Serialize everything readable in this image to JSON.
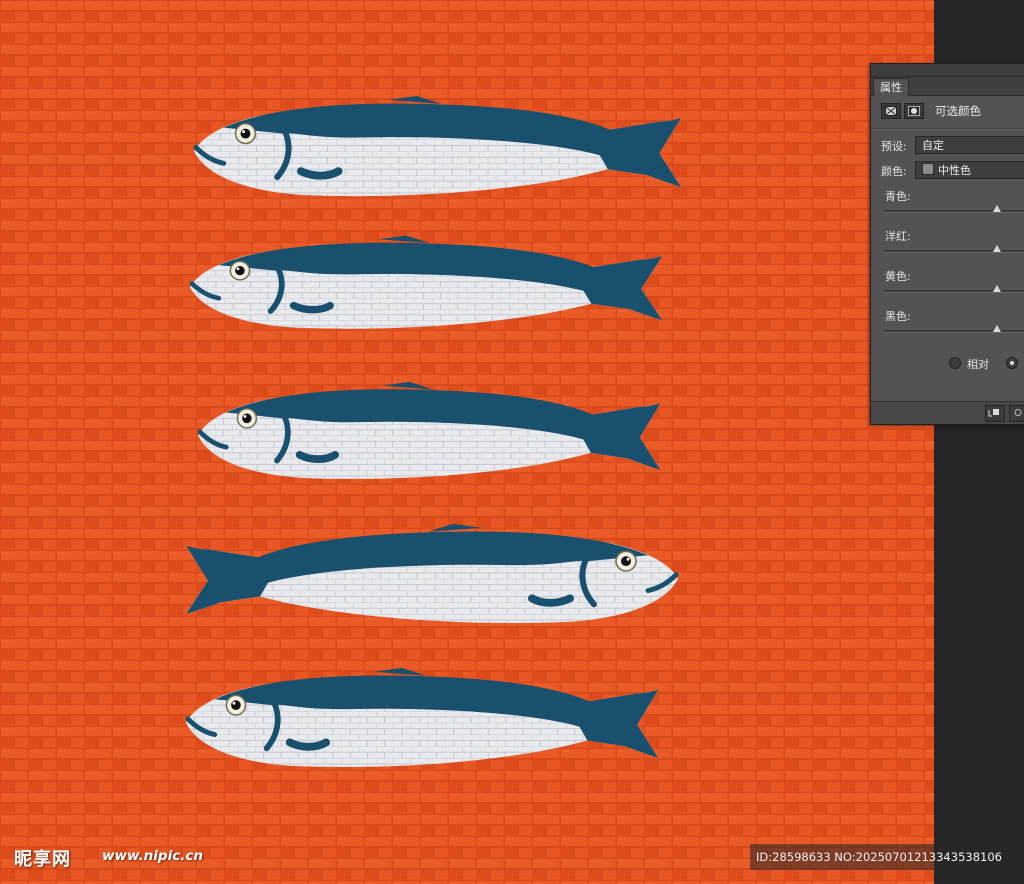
{
  "colors": {
    "canvas_orange": "#e4511f",
    "fish_blue": "#19506e",
    "fish_belly": "#e9eaee",
    "panel_bg": "#535353",
    "workspace_dark": "#262626"
  },
  "canvas": {
    "artwork": "five sardines on orange brick-textured background",
    "fish_count": 5
  },
  "properties_panel": {
    "tab_label": "属性",
    "adjustment_icons": [
      "adjustment-layer-icon",
      "mask-icon"
    ],
    "title": "可选颜色",
    "preset_label": "预设:",
    "preset_value": "自定",
    "colors_label": "颜色:",
    "colors_value": "中性色",
    "sliders": [
      {
        "label": "青色:",
        "value_fraction": 0.75
      },
      {
        "label": "洋红:",
        "value_fraction": 0.75
      },
      {
        "label": "黄色:",
        "value_fraction": 0.75
      },
      {
        "label": "黑色:",
        "value_fraction": 0.75
      }
    ],
    "mode_relative": "相对",
    "mode_selected": "absolute"
  },
  "watermark": {
    "logo": "昵享网",
    "url": "www.nipic.cn",
    "id_text": "ID:28598633 NO:20250701213343538106"
  }
}
